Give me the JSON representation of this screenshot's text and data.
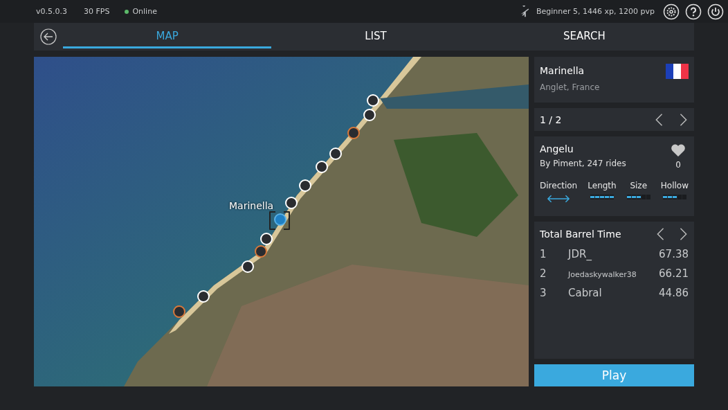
{
  "status_bar": {
    "version": "v0.5.0.3",
    "fps": "30 FPS",
    "connection": {
      "label": "Online",
      "online": true
    },
    "player": "Beginner 5, 1446 xp, 1200 pvp"
  },
  "tabs": [
    {
      "label": "MAP",
      "selected": true
    },
    {
      "label": "LIST",
      "selected": false
    },
    {
      "label": "SEARCH",
      "selected": false
    }
  ],
  "map": {
    "label": "Marinella",
    "markers": [
      {
        "kind": "spot",
        "selected": false
      },
      {
        "kind": "spot",
        "selected": false
      },
      {
        "kind": "other",
        "selected": false
      },
      {
        "kind": "spot",
        "selected": false
      },
      {
        "kind": "spot",
        "selected": false
      },
      {
        "kind": "spot",
        "selected": false
      },
      {
        "kind": "spot",
        "selected": false
      },
      {
        "kind": "spot",
        "selected": true
      },
      {
        "kind": "spot",
        "selected": false
      },
      {
        "kind": "other",
        "selected": false
      },
      {
        "kind": "spot",
        "selected": false
      },
      {
        "kind": "spot",
        "selected": false
      },
      {
        "kind": "other",
        "selected": false
      }
    ]
  },
  "spot": {
    "name": "Marinella",
    "location": "Anglet, France"
  },
  "pager": {
    "label": "1 / 2"
  },
  "wave": {
    "name": "Angelu",
    "byline": "By Piment, 247 rides",
    "favorite": false,
    "likes": "0",
    "stats": [
      {
        "label": "Direction",
        "kind": "direction"
      },
      {
        "label": "Length",
        "kind": "meter",
        "level": 1
      },
      {
        "label": "Size",
        "kind": "meter",
        "level": 0.6
      },
      {
        "label": "Hollow",
        "kind": "meter",
        "level": 0.6
      }
    ]
  },
  "leaderboard": {
    "title": "Total Barrel Time",
    "rows": [
      {
        "rank": "1",
        "name": "JDR_",
        "score": "67.38"
      },
      {
        "rank": "2",
        "name": "Joedaskywalker38",
        "score": "66.21"
      },
      {
        "rank": "3",
        "name": "Cabral",
        "score": "44.86"
      }
    ]
  },
  "play_button": "Play"
}
